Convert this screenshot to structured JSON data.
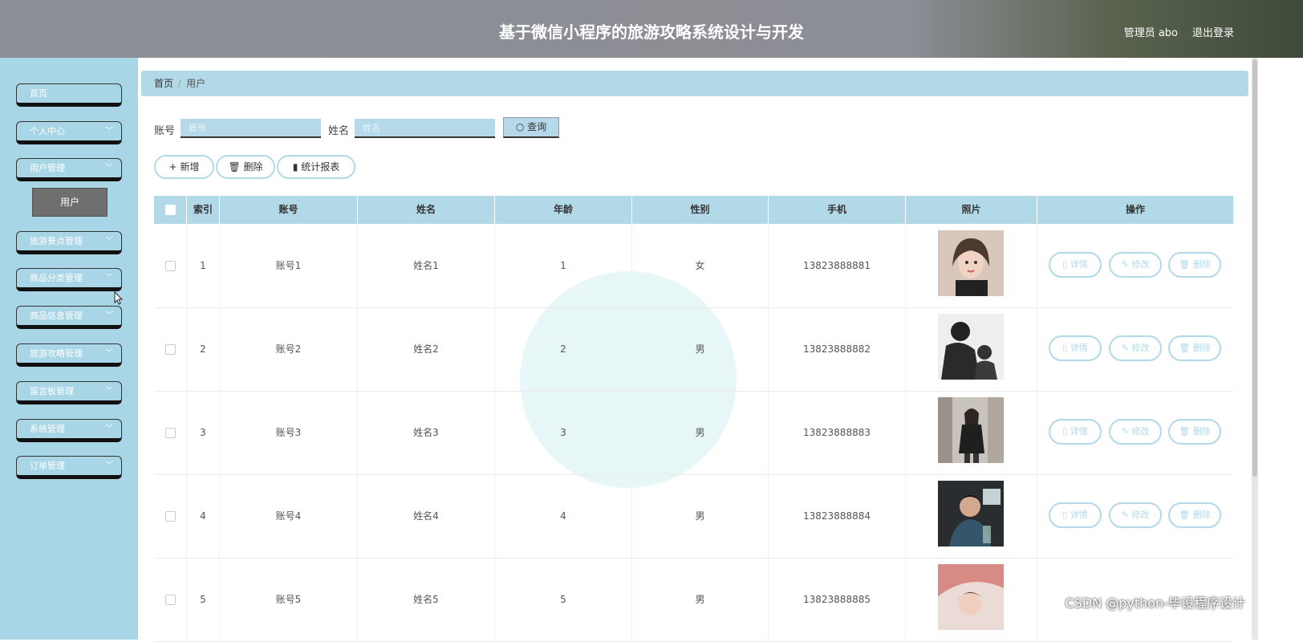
{
  "header": {
    "title": "基于微信小程序的旅游攻略系统设计与开发",
    "user": "管理员 abo",
    "logout": "退出登录"
  },
  "sidebar": {
    "items": [
      {
        "label": "首页",
        "has_chevron": false
      },
      {
        "label": "个人中心",
        "has_chevron": true
      },
      {
        "label": "用户管理",
        "has_chevron": true
      },
      {
        "label": "旅游景点管理",
        "has_chevron": true
      },
      {
        "label": "商品分类管理",
        "has_chevron": true
      },
      {
        "label": "商品信息管理",
        "has_chevron": true
      },
      {
        "label": "旅游攻略管理",
        "has_chevron": true
      },
      {
        "label": "留言板管理",
        "has_chevron": true
      },
      {
        "label": "系统管理",
        "has_chevron": true
      },
      {
        "label": "订单管理",
        "has_chevron": true
      }
    ],
    "sub_item": "用户"
  },
  "breadcrumb": {
    "home": "首页",
    "current": "用户"
  },
  "search": {
    "account_label": "账号",
    "account_placeholder": "账号",
    "name_label": "姓名",
    "name_placeholder": "姓名",
    "query_button": "查询"
  },
  "toolbar": {
    "add": "新增",
    "delete": "删除",
    "stats": "统计报表"
  },
  "table": {
    "headers": [
      "索引",
      "账号",
      "姓名",
      "年龄",
      "性别",
      "手机",
      "照片",
      "操作"
    ],
    "rows": [
      {
        "index": "1",
        "account": "账号1",
        "name": "姓名1",
        "age": "1",
        "gender": "女",
        "phone": "13823888881"
      },
      {
        "index": "2",
        "account": "账号2",
        "name": "姓名2",
        "age": "2",
        "gender": "男",
        "phone": "13823888882"
      },
      {
        "index": "3",
        "account": "账号3",
        "name": "姓名3",
        "age": "3",
        "gender": "男",
        "phone": "13823888883"
      },
      {
        "index": "4",
        "account": "账号4",
        "name": "姓名4",
        "age": "4",
        "gender": "男",
        "phone": "13823888884"
      },
      {
        "index": "5",
        "account": "账号5",
        "name": "姓名5",
        "age": "5",
        "gender": "男",
        "phone": "13823888885"
      }
    ],
    "actions": {
      "detail": "详情",
      "edit": "修改",
      "delete": "删除"
    }
  },
  "watermark": "CSDN @python-毕设程序设计"
}
